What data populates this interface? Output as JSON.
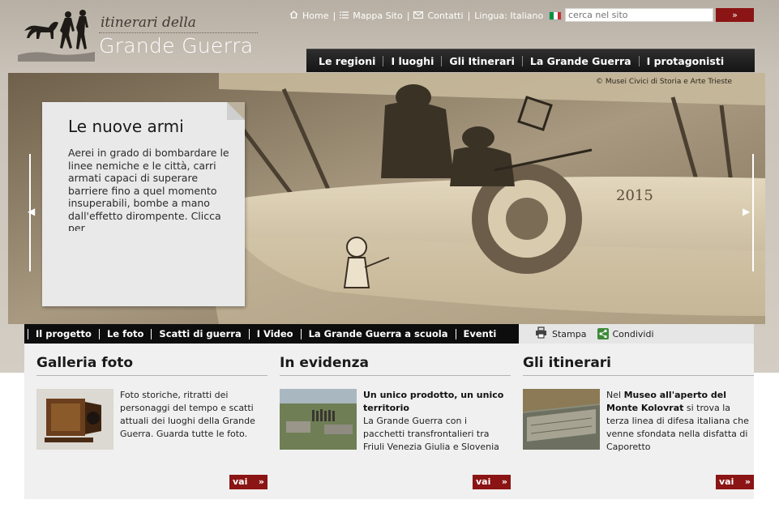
{
  "header": {
    "logo_top": "itinerari della",
    "logo_main": "Grande Guerra",
    "util": {
      "home": "Home",
      "sitemap": "Mappa Sito",
      "contacts": "Contatti",
      "language": "Lingua: Italiano"
    },
    "search_placeholder": "cerca nel sito",
    "search_button": "»"
  },
  "mainnav": [
    "Le regioni",
    "I luoghi",
    "Gli Itinerari",
    "La Grande Guerra",
    "I protagonisti"
  ],
  "hero": {
    "credit": "© Musei Civici di Storia e Arte Trieste",
    "title": "Le nuove armi",
    "text": "Aerei in grado di bombardare le linee nemiche e le città, carri armati capaci di superare barriere fino a quel momento insuperabili, bombe a mano dall'effetto dirompente. Clicca per",
    "plane_number": "2015"
  },
  "subnav": [
    "Il progetto",
    "Le foto",
    "Scatti di guerra",
    "I Video",
    "La Grande Guerra a scuola",
    "Eventi"
  ],
  "tools": {
    "print": "Stampa",
    "share": "Condividi"
  },
  "columns": {
    "gallery": {
      "title": "Galleria foto",
      "text": "Foto storiche, ritratti dei personaggi del tempo e scatti attuali dei luoghi della Grande Guerra. Guarda tutte le foto.",
      "more": "vai"
    },
    "featured": {
      "title": "In evidenza",
      "headline": "Un unico prodotto, un unico territorio",
      "text": "La Grande Guerra con i pacchetti transfrontalieri tra Friuli Venezia Giulia e Slovenia",
      "more": "vai"
    },
    "itineraries": {
      "title": "Gli itinerari",
      "text_pre": "Nel ",
      "text_bold": "Museo all'aperto del Monte Kolovrat",
      "text_post": " si trova la terza linea di difesa italiana che venne sfondata nella disfatta di Caporetto",
      "more": "vai"
    }
  },
  "colors": {
    "accent": "#8b1414",
    "nav": "#151515",
    "panel": "#f0f0f0"
  }
}
